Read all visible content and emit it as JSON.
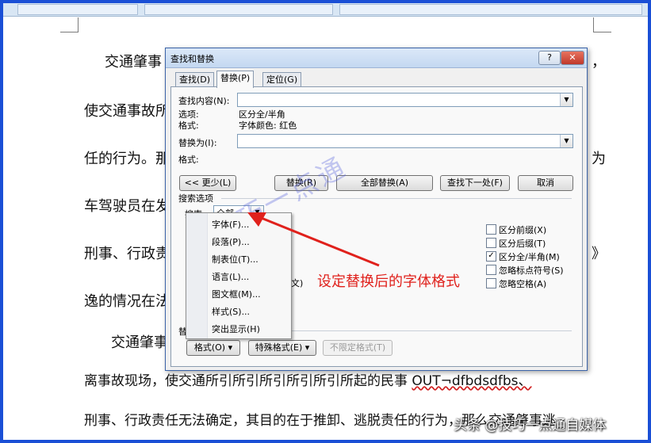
{
  "colors": {
    "frame": "#1a4fd6",
    "annotation": "#e0211c",
    "watermark": "#5a64dc"
  },
  "document": {
    "lines": [
      "交通肇事",
      "使交通事故所",
      "任的行为。那",
      "车驾驶员在发",
      "刑事、行政责",
      "逸的情况在法",
      "交通肇事",
      "离事故现场，使交通所引所引所引所引所引所起的民事",
      "OUT¬dfbdsdfbs、",
      "刑事、行政责任无法确定，其目的在于推卸、逃脱责任的行为，那么交通肇事逃"
    ],
    "edge_chars": [
      "，",
      "为",
      "》"
    ]
  },
  "dialog": {
    "title": "查找和替换",
    "help_label": "?",
    "close_label": "✕",
    "tabs": [
      "查找(D)",
      "替换(P)",
      "定位(G)"
    ],
    "find_label": "查找内容(N):",
    "find_value": "",
    "options_label": "选项:",
    "options_value": "区分全/半角",
    "format_label": "格式:",
    "format_value": "字体颜色: 红色",
    "replace_label": "替换为(I):",
    "replace_value": "",
    "replace_format_label": "格式:",
    "buttons": {
      "less": "<< 更少(L)",
      "replace": "替换(R)",
      "replace_all": "全部替换(A)",
      "find_next": "查找下一处(F)",
      "cancel": "取消"
    },
    "search_options_label": "搜索选项",
    "search_label": "搜索:",
    "search_value": "全部",
    "partial_label": "文)",
    "right_options": [
      {
        "label": "区分前缀(X)",
        "checked": false
      },
      {
        "label": "区分后缀(T)",
        "checked": false
      },
      {
        "label": "区分全/半角(M)",
        "checked": true
      },
      {
        "label": "忽略标点符号(S)",
        "checked": false
      },
      {
        "label": "忽略空格(A)",
        "checked": false
      }
    ],
    "replace_section_label": "替",
    "bottom_buttons": {
      "format": "格式(O) ▾",
      "special": "特殊格式(E) ▾",
      "no_format": "不限定格式(T)"
    }
  },
  "format_menu": {
    "items": [
      "字体(F)...",
      "段落(P)...",
      "制表位(T)...",
      "语言(L)...",
      "图文框(M)...",
      "样式(S)...",
      "突出显示(H)"
    ]
  },
  "annotation": "设定替换后的字体格式",
  "watermark": "技巧一点通",
  "credit": "头条 @技巧一点通自媒体"
}
